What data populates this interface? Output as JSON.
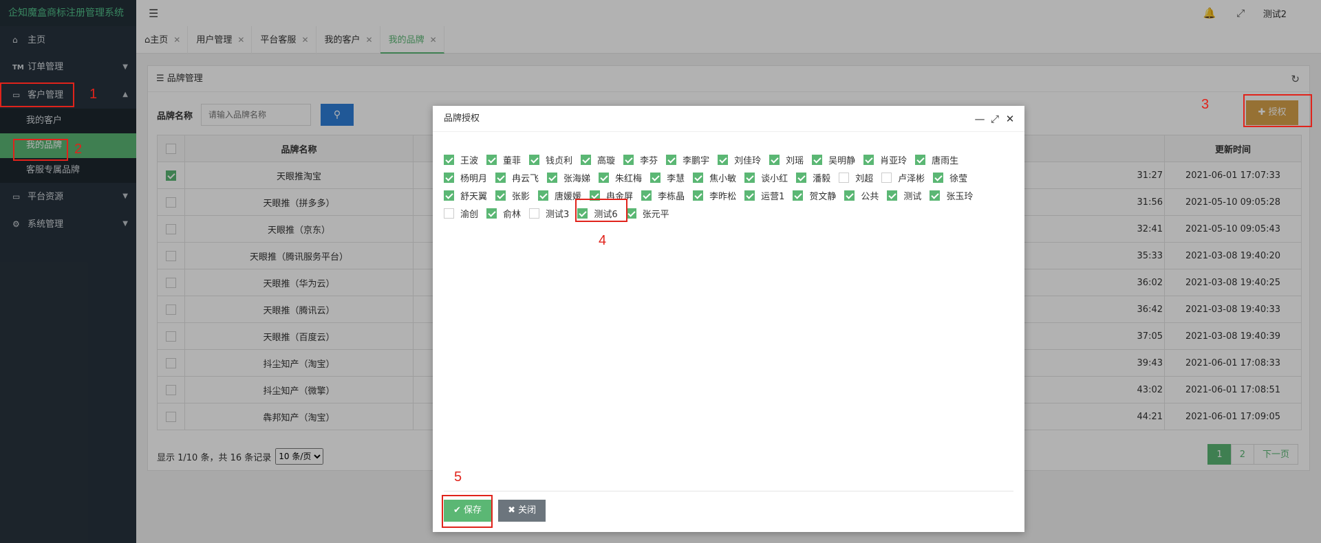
{
  "app": {
    "title": "企知魔盒商标注册管理系统"
  },
  "sidebar": {
    "items": [
      {
        "label": "主页",
        "icon": "home-icon"
      },
      {
        "label": "订单管理",
        "icon": "tm-icon",
        "icon_text": "TM"
      },
      {
        "label": "客户管理",
        "icon": "monitor-icon",
        "expanded": true,
        "sub": [
          {
            "label": "我的客户"
          },
          {
            "label": "我的品牌",
            "active": true
          },
          {
            "label": "客服专属品牌"
          }
        ]
      },
      {
        "label": "平台资源",
        "icon": "monitor-icon"
      },
      {
        "label": "系统管理",
        "icon": "gear-icon"
      }
    ]
  },
  "topbar": {
    "user": "测试2",
    "icons": [
      "bell-icon",
      "fullscreen-icon"
    ]
  },
  "tabs": [
    {
      "label": "主页",
      "icon": "home-icon"
    },
    {
      "label": "用户管理"
    },
    {
      "label": "平台客服"
    },
    {
      "label": "我的客户"
    },
    {
      "label": "我的品牌",
      "active": true
    }
  ],
  "panel": {
    "title": "品牌管理",
    "search": {
      "label": "品牌名称",
      "placeholder": "请输入品牌名称"
    },
    "auth_button": "授权",
    "table": {
      "columns": [
        "品牌名称",
        "更新时间"
      ],
      "rows": [
        {
          "name": "天眼推淘宝",
          "mid": "31:27",
          "updated": "2021-06-01 17:07:33",
          "checked": true
        },
        {
          "name": "天眼推（拼多多）",
          "mid": "31:56",
          "updated": "2021-05-10 09:05:28",
          "checked": false
        },
        {
          "name": "天眼推（京东）",
          "mid": "32:41",
          "updated": "2021-05-10 09:05:43",
          "checked": false
        },
        {
          "name": "天眼推（腾讯服务平台）",
          "mid": "35:33",
          "updated": "2021-03-08 19:40:20",
          "checked": false
        },
        {
          "name": "天眼推（华为云）",
          "mid": "36:02",
          "updated": "2021-03-08 19:40:25",
          "checked": false
        },
        {
          "name": "天眼推（腾讯云）",
          "mid": "36:42",
          "updated": "2021-03-08 19:40:33",
          "checked": false
        },
        {
          "name": "天眼推（百度云）",
          "mid": "37:05",
          "updated": "2021-03-08 19:40:39",
          "checked": false
        },
        {
          "name": "抖尘知产（淘宝）",
          "mid": "39:43",
          "updated": "2021-06-01 17:08:33",
          "checked": false
        },
        {
          "name": "抖尘知产（微擎）",
          "mid": "43:02",
          "updated": "2021-06-01 17:08:51",
          "checked": false
        },
        {
          "name": "犇邦知产（淘宝）",
          "mid": "44:21",
          "updated": "2021-06-01 17:09:05",
          "checked": false
        }
      ]
    },
    "pager_info": "显示 1/10 条，共 16 条记录",
    "page_size": "10 条/页",
    "pages": [
      "1",
      "2",
      "下一页"
    ]
  },
  "modal": {
    "title": "品牌授权",
    "users": [
      {
        "name": "王波",
        "checked": true
      },
      {
        "name": "董菲",
        "checked": true
      },
      {
        "name": "钱贞利",
        "checked": true
      },
      {
        "name": "高璇",
        "checked": true
      },
      {
        "name": "李芬",
        "checked": true
      },
      {
        "name": "李鹏宇",
        "checked": true
      },
      {
        "name": "刘佳玲",
        "checked": true
      },
      {
        "name": "刘瑶",
        "checked": true
      },
      {
        "name": "吴明静",
        "checked": true
      },
      {
        "name": "肖亚玲",
        "checked": true
      },
      {
        "name": "唐雨生",
        "checked": true
      },
      {
        "name": "杨明月",
        "checked": true
      },
      {
        "name": "冉云飞",
        "checked": true
      },
      {
        "name": "张海娣",
        "checked": true
      },
      {
        "name": "朱红梅",
        "checked": true
      },
      {
        "name": "李慧",
        "checked": true
      },
      {
        "name": "焦小敏",
        "checked": true
      },
      {
        "name": "谈小红",
        "checked": true
      },
      {
        "name": "潘毅",
        "checked": true
      },
      {
        "name": "刘超",
        "checked": false
      },
      {
        "name": "卢泽彬",
        "checked": false
      },
      {
        "name": "徐莹",
        "checked": true
      },
      {
        "name": "舒天翼",
        "checked": true
      },
      {
        "name": "张影",
        "checked": true
      },
      {
        "name": "唐媛媛",
        "checked": true
      },
      {
        "name": "冉金屏",
        "checked": true
      },
      {
        "name": "李栋晶",
        "checked": true
      },
      {
        "name": "李昨松",
        "checked": true
      },
      {
        "name": "运营1",
        "checked": true
      },
      {
        "name": "贺文静",
        "checked": true
      },
      {
        "name": "公共",
        "checked": true
      },
      {
        "name": "测试",
        "checked": true
      },
      {
        "name": "张玉玲",
        "checked": true
      },
      {
        "name": "渝创",
        "checked": false
      },
      {
        "name": "俞林",
        "checked": true
      },
      {
        "name": "测试3",
        "checked": false
      },
      {
        "name": "测试6",
        "checked": true
      },
      {
        "name": "张元平",
        "checked": true
      }
    ],
    "save_label": "保存",
    "close_label": "关闭"
  },
  "annotations": {
    "n1": "1",
    "n2": "2",
    "n3": "3",
    "n4": "4",
    "n5": "5",
    "color": "#e0231b"
  }
}
